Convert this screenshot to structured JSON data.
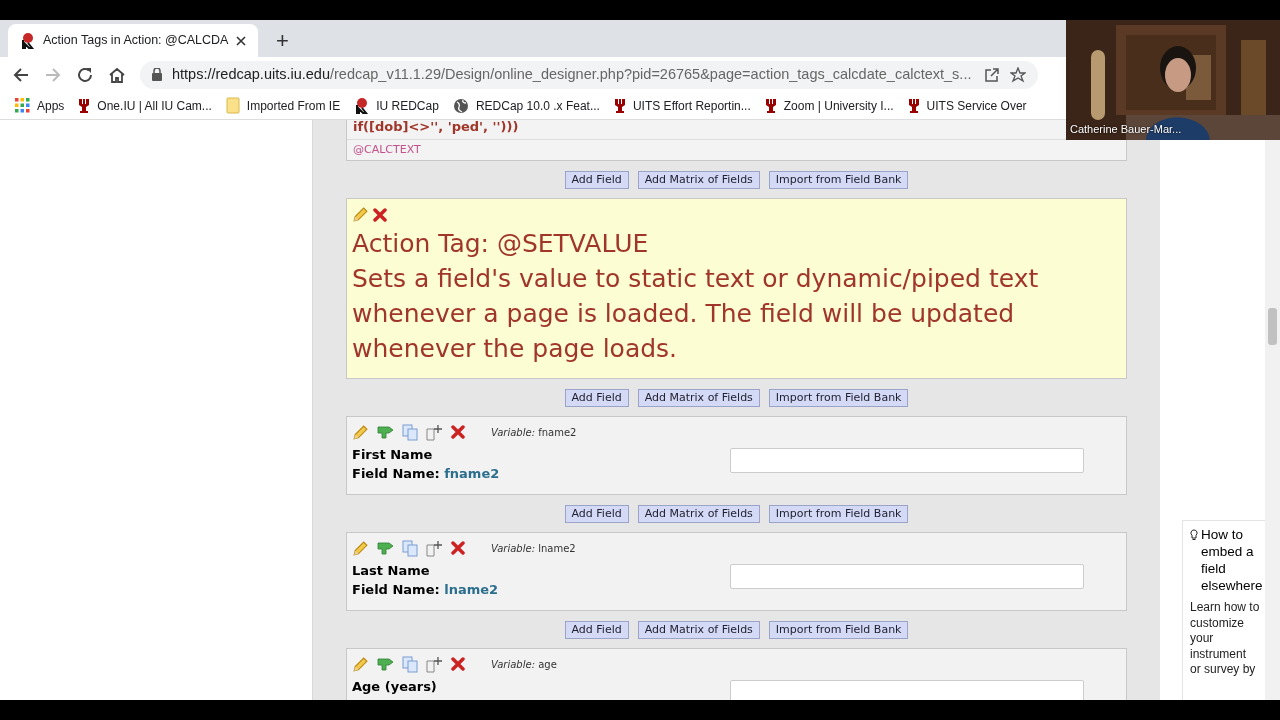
{
  "browser": {
    "tab": {
      "title": "Action Tags in Action: @CALCDA",
      "selected": true
    },
    "new_tab": "+",
    "url": {
      "host": "https://redcap.uits.iu.edu",
      "path": "/redcap_v11.1.29/Design/online_designer.php?pid=26765&page=action_tags_calcdate_calctext_s..."
    },
    "bookmarks": [
      {
        "label": "Apps",
        "kind": "apps"
      },
      {
        "label": "One.IU | All IU Cam...",
        "kind": "iu"
      },
      {
        "label": "Imported From IE",
        "kind": "folder"
      },
      {
        "label": "IU REDCap",
        "kind": "redcap"
      },
      {
        "label": "REDCap 10.0 .x Feat...",
        "kind": "globe"
      },
      {
        "label": "UITS Effort Reportin...",
        "kind": "iu"
      },
      {
        "label": "Zoom | University I...",
        "kind": "iu"
      },
      {
        "label": "UITS Service Over",
        "kind": "iu"
      }
    ]
  },
  "video": {
    "name": "Catherine Bauer-Mar..."
  },
  "blocks": [
    {
      "kind": "code_tail",
      "code": "if([dob]<>'', 'ped', '')))",
      "tag": "@CALCTEXT",
      "add_buttons": [
        "Add Field",
        "Add Matrix of Fields",
        "Import from Field Bank"
      ]
    },
    {
      "kind": "descriptive",
      "title": "Action Tag: @SETVALUE",
      "text": "Sets a field's value to static text or dynamic/piped text whenever a page is loaded. The field will be updated whenever the page loads.",
      "add_buttons": [
        "Add Field",
        "Add Matrix of Fields",
        "Import from Field Bank"
      ]
    },
    {
      "kind": "text",
      "variable_label": "Variable:",
      "variable": "fname2",
      "label": "First Name",
      "field_name_label": "Field Name:",
      "field_name": "fname2",
      "add_buttons": [
        "Add Field",
        "Add Matrix of Fields",
        "Import from Field Bank"
      ]
    },
    {
      "kind": "text",
      "variable_label": "Variable:",
      "variable": "lname2",
      "label": "Last Name",
      "field_name_label": "Field Name:",
      "field_name": "lname2",
      "add_buttons": [
        "Add Field",
        "Add Matrix of Fields",
        "Import from Field Bank"
      ]
    },
    {
      "kind": "text",
      "variable_label": "Variable:",
      "variable": "age",
      "label": "Age (years)"
    }
  ],
  "help": {
    "title": "How to embed a field elsewhere",
    "text": "Learn how to customize your instrument or survey by"
  }
}
